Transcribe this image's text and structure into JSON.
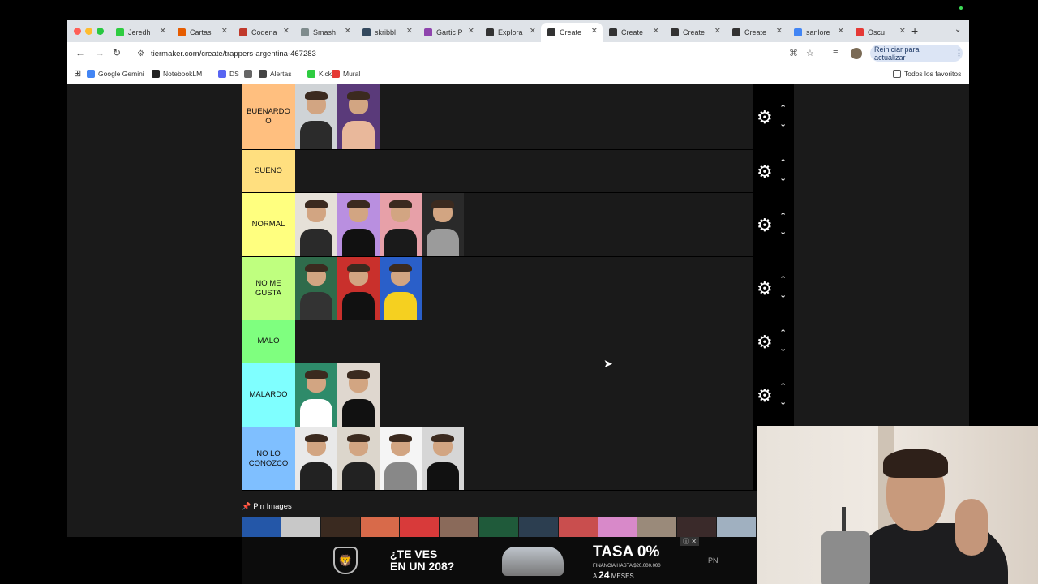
{
  "browser": {
    "tabs": [
      {
        "label": "Jeredh",
        "favicon_color": "#2ecc40"
      },
      {
        "label": "Cartas",
        "favicon_color": "#e65c00"
      },
      {
        "label": "Codena",
        "favicon_color": "#c0392b"
      },
      {
        "label": "Smash",
        "favicon_color": "#7f8c8d"
      },
      {
        "label": "skribbl",
        "favicon_color": "#34495e"
      },
      {
        "label": "Gartic P",
        "favicon_color": "#8e44ad"
      },
      {
        "label": "Explora",
        "favicon_color": "#333333"
      },
      {
        "label": "Create",
        "favicon_color": "#333333",
        "active": true
      },
      {
        "label": "Create",
        "favicon_color": "#333333"
      },
      {
        "label": "Create",
        "favicon_color": "#333333"
      },
      {
        "label": "Create",
        "favicon_color": "#333333"
      },
      {
        "label": "sanlore",
        "favicon_color": "#4285f4"
      },
      {
        "label": "Oscu",
        "favicon_color": "#e53935"
      }
    ],
    "url": "tiermaker.com/create/trappers-argentina-467283",
    "update_button": "Reiniciar para actualizar",
    "bookmarks": [
      {
        "label": "Google Gemini",
        "color": "#4285f4"
      },
      {
        "label": "NotebookLM",
        "color": "#222222"
      },
      {
        "label": "DS",
        "color": "#5865f2"
      },
      {
        "label": "",
        "color": "#666666"
      },
      {
        "label": "Alertas",
        "color": "#444444"
      },
      {
        "label": "Kick",
        "color": "#2ecc40"
      },
      {
        "label": "Mural",
        "color": "#e53935"
      }
    ],
    "all_bookmarks": "Todos los favoritos"
  },
  "tierlist": {
    "tiers": [
      {
        "label": "BUENARDO O",
        "color": "#ffbf7f",
        "items": 2
      },
      {
        "label": "SUENO",
        "color": "#ffdf7f",
        "items": 0
      },
      {
        "label": "NORMAL",
        "color": "#ffff7f",
        "items": 4
      },
      {
        "label": "NO ME GUSTA",
        "color": "#bfff7f",
        "items": 3
      },
      {
        "label": "MALO",
        "color": "#7fff7f",
        "items": 0
      },
      {
        "label": "MALARDO",
        "color": "#7fffff",
        "items": 2
      },
      {
        "label": "NO LO CONOZCO",
        "color": "#7fbfff",
        "items": 4
      }
    ],
    "controls": {
      "gear": "⚙",
      "up": "⌃",
      "down": "⌄"
    }
  },
  "pin": {
    "label": "Pin Images"
  },
  "ad": {
    "logo": "🦁",
    "headline_1": "¿TE VES",
    "headline_2": "EN UN 208?",
    "rate": "TASA 0%",
    "financing": "FINANCIA HASTA $20.000.000",
    "months_prefix": "A",
    "months_value": "24",
    "months_suffix": "MESES",
    "brand": "PN",
    "ad_badge": "ⓘ ✕"
  }
}
